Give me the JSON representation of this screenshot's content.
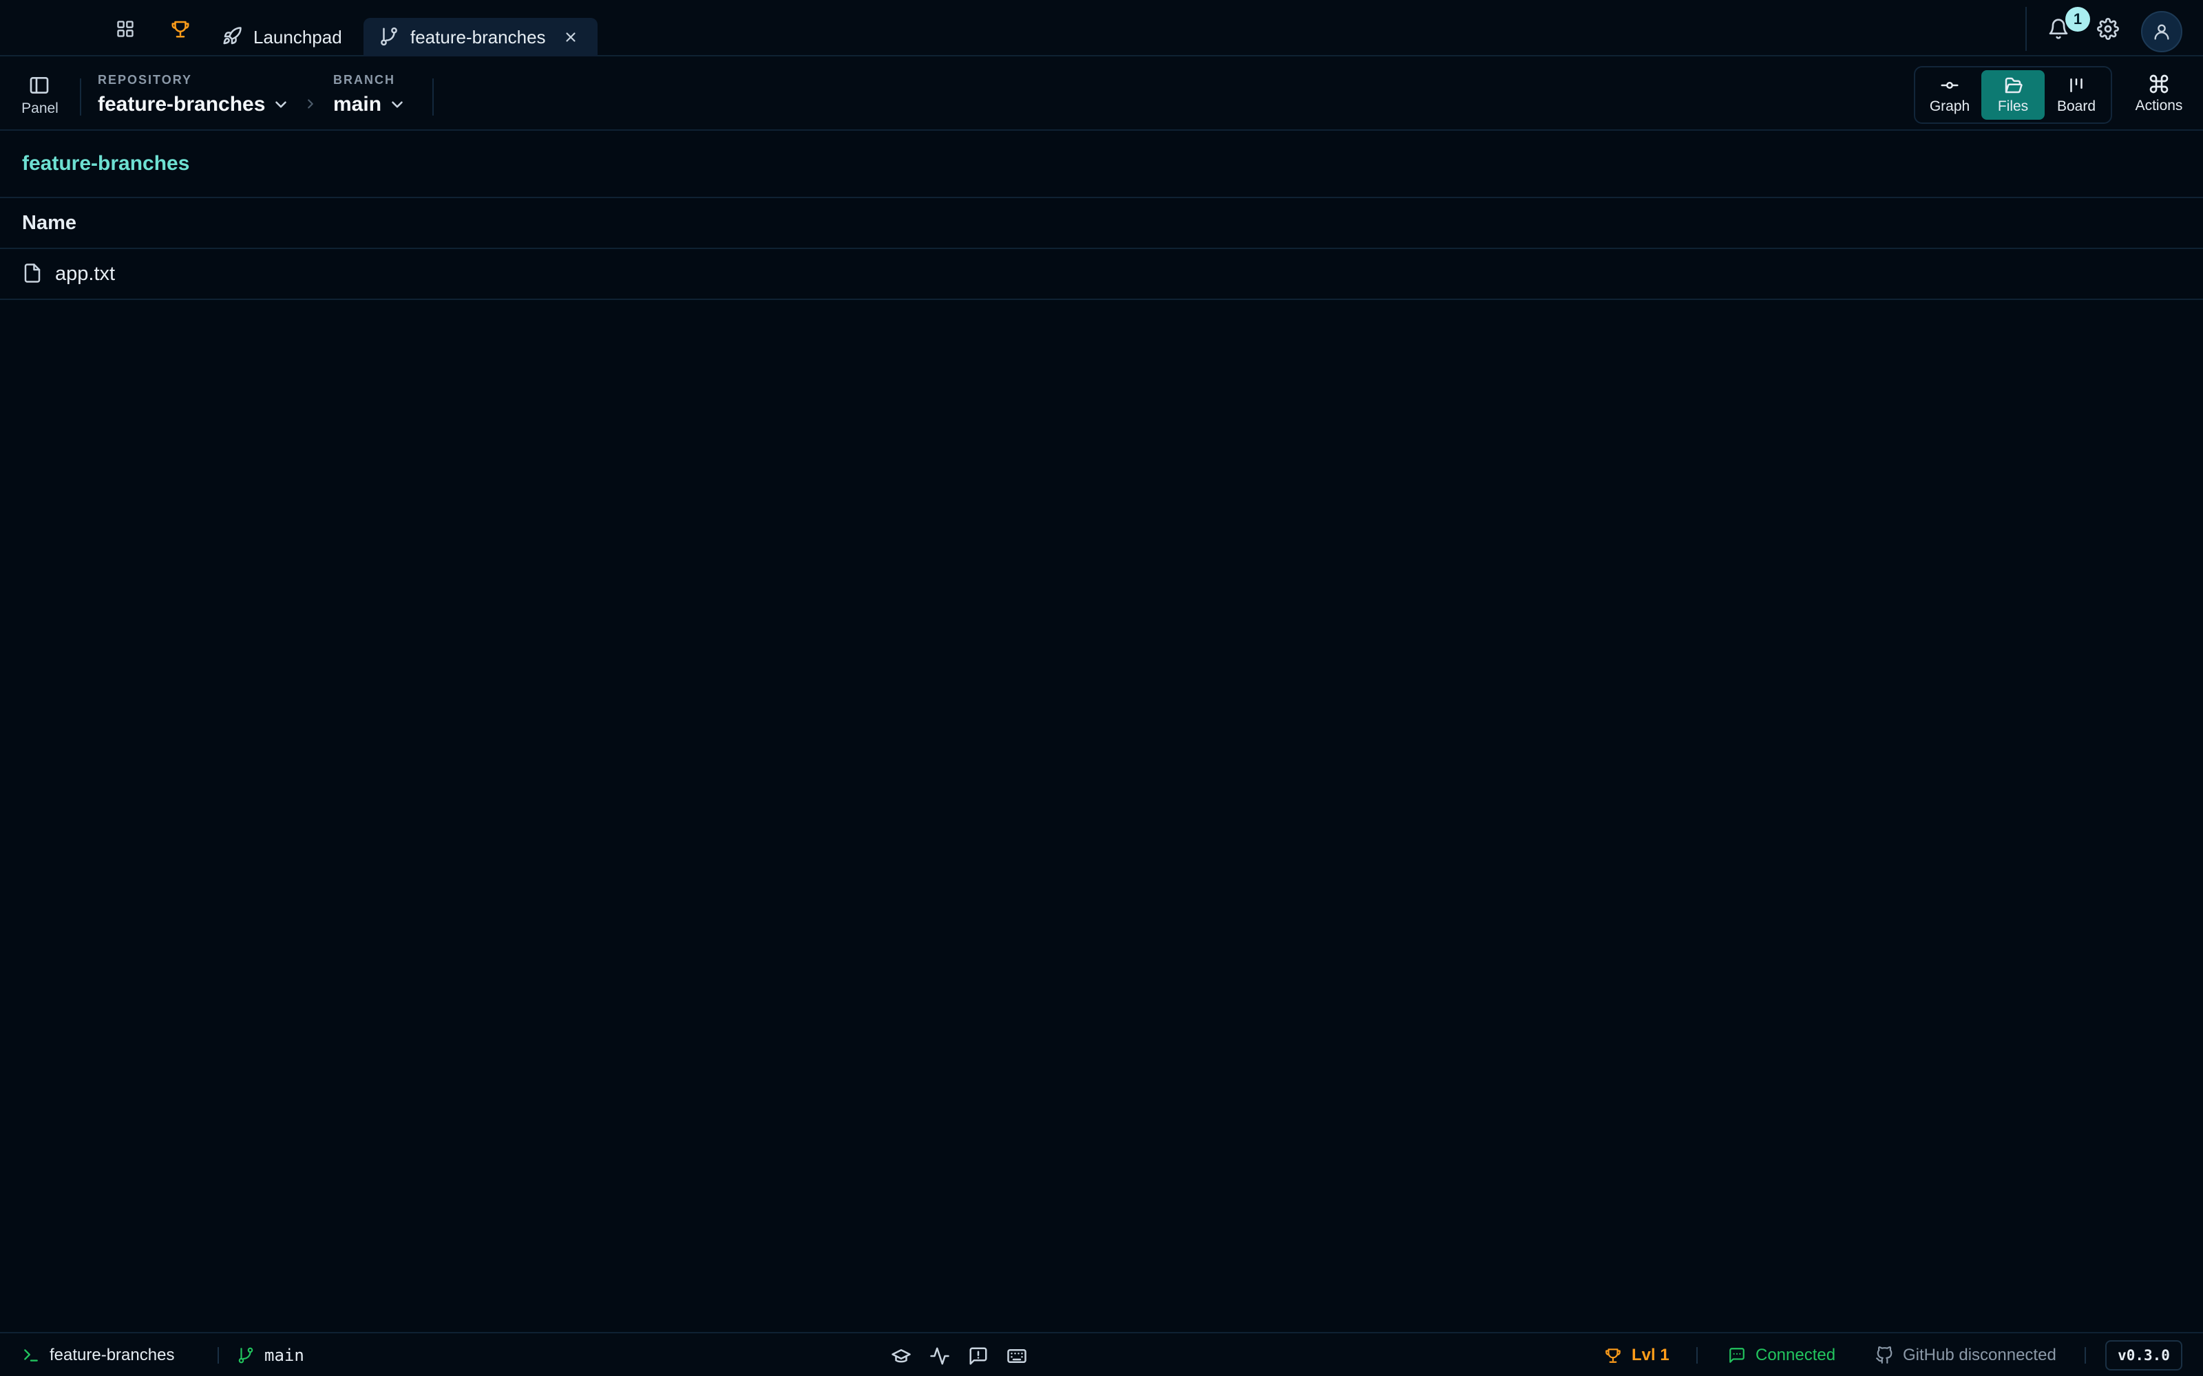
{
  "tabbar": {
    "icons": [
      "grid-icon",
      "trophy-icon"
    ],
    "tabs": [
      {
        "label": "Launchpad",
        "icon": "rocket-icon",
        "active": false
      },
      {
        "label": "feature-branches",
        "icon": "git-branch-icon",
        "active": true,
        "closable": true
      }
    ],
    "notifications": {
      "count": "1"
    },
    "accent_color": "#ff9d1a"
  },
  "toolbar": {
    "panel_label": "Panel",
    "repository": {
      "label": "Repository",
      "value": "feature-branches"
    },
    "branch": {
      "label": "Branch",
      "value": "main"
    },
    "views": [
      {
        "label": "Graph",
        "icon": "commit-graph-icon",
        "active": false
      },
      {
        "label": "Files",
        "icon": "folder-open-icon",
        "active": true
      },
      {
        "label": "Board",
        "icon": "board-icon",
        "active": false
      }
    ],
    "actions_label": "Actions",
    "active_view_color": "#0d7a72"
  },
  "content": {
    "path": "feature-branches",
    "column_header": "Name",
    "files": [
      {
        "name": "app.txt",
        "icon": "file-icon"
      }
    ]
  },
  "statusbar": {
    "repo": "feature-branches",
    "branch": "main",
    "center_icons": [
      "graduation-cap-icon",
      "activity-icon",
      "feedback-icon",
      "keyboard-icon"
    ],
    "level": "Lvl 1",
    "connection": "Connected",
    "github": "GitHub disconnected",
    "version": "v0.3.0",
    "colors": {
      "level": "#ff9d1a",
      "connected": "#22c55e",
      "muted": "#8b99a8",
      "branch": "#22c55e"
    }
  }
}
